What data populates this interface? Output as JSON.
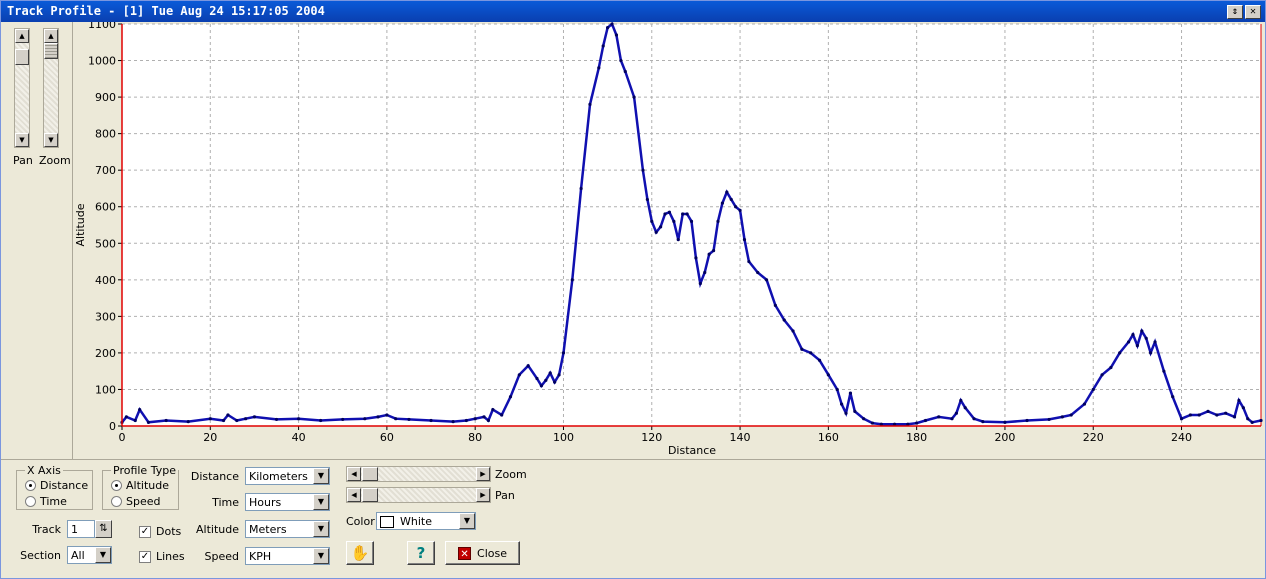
{
  "window": {
    "title": "Track Profile - [1] Tue Aug 24 15:17:05 2004",
    "restore_icon": "restore-icon",
    "close_icon": "close-icon"
  },
  "left_panel": {
    "pan_label": "Pan",
    "zoom_label": "Zoom"
  },
  "chart_data": {
    "type": "line",
    "xlabel": "Distance",
    "ylabel": "Altitude",
    "xlim": [
      0,
      258
    ],
    "ylim": [
      0,
      1100
    ],
    "xticks": [
      0,
      20,
      40,
      60,
      80,
      100,
      120,
      140,
      160,
      180,
      200,
      220,
      240
    ],
    "yticks": [
      0,
      100,
      200,
      300,
      400,
      500,
      600,
      700,
      800,
      900,
      1000,
      1100
    ],
    "ytick_labels": [
      "0",
      "100",
      "200",
      "300",
      "400",
      "500",
      "600",
      "700",
      "800",
      "900",
      "1000",
      "1100"
    ],
    "grid": true,
    "series_color": "#1010b0",
    "axis_color": "#e00000",
    "x": [
      0,
      1,
      3,
      4,
      6,
      10,
      15,
      20,
      23,
      24,
      26,
      28,
      30,
      35,
      40,
      45,
      50,
      55,
      58,
      60,
      62,
      65,
      70,
      75,
      78,
      80,
      82,
      83,
      84,
      86,
      88,
      90,
      92,
      94,
      95,
      96,
      97,
      98,
      99,
      100,
      102,
      104,
      106,
      108,
      109,
      110,
      111,
      112,
      113,
      114,
      116,
      118,
      119,
      120,
      121,
      122,
      123,
      124,
      125,
      126,
      127,
      128,
      129,
      130,
      131,
      132,
      133,
      134,
      135,
      136,
      137,
      138,
      139,
      140,
      141,
      142,
      144,
      146,
      148,
      150,
      152,
      154,
      156,
      158,
      160,
      162,
      163,
      164,
      165,
      166,
      168,
      170,
      172,
      175,
      178,
      180,
      182,
      185,
      188,
      189,
      190,
      191,
      193,
      195,
      200,
      205,
      210,
      213,
      215,
      218,
      220,
      222,
      224,
      226,
      228,
      229,
      230,
      231,
      232,
      233,
      234,
      236,
      238,
      240,
      242,
      244,
      246,
      248,
      250,
      252,
      253,
      254,
      255,
      256,
      258
    ],
    "y": [
      10,
      25,
      15,
      45,
      10,
      15,
      12,
      20,
      15,
      30,
      15,
      20,
      25,
      18,
      20,
      15,
      18,
      20,
      25,
      30,
      20,
      18,
      15,
      12,
      15,
      20,
      25,
      15,
      45,
      30,
      80,
      140,
      165,
      130,
      110,
      125,
      145,
      120,
      140,
      200,
      400,
      650,
      880,
      980,
      1040,
      1090,
      1100,
      1070,
      1000,
      970,
      900,
      700,
      620,
      560,
      530,
      545,
      580,
      585,
      560,
      510,
      580,
      580,
      560,
      460,
      390,
      420,
      470,
      480,
      560,
      610,
      640,
      620,
      600,
      590,
      510,
      450,
      420,
      400,
      330,
      290,
      260,
      210,
      200,
      180,
      140,
      100,
      60,
      35,
      90,
      40,
      20,
      8,
      5,
      5,
      5,
      8,
      15,
      25,
      20,
      35,
      70,
      50,
      20,
      12,
      10,
      15,
      18,
      25,
      30,
      60,
      100,
      140,
      160,
      200,
      230,
      250,
      220,
      260,
      240,
      200,
      230,
      150,
      80,
      20,
      30,
      30,
      40,
      30,
      35,
      25,
      70,
      50,
      20,
      10,
      15
    ]
  },
  "controls": {
    "xaxis_group_title": "X Axis",
    "xaxis_distance": "Distance",
    "xaxis_time": "Time",
    "profile_group_title": "Profile Type",
    "profile_altitude": "Altitude",
    "profile_speed": "Speed",
    "track_label": "Track",
    "track_value": "1",
    "section_label": "Section",
    "section_value": "All",
    "dots_label": "Dots",
    "lines_label": "Lines",
    "distance_label": "Distance",
    "distance_value": "Kilometers",
    "time_label": "Time",
    "time_value": "Hours",
    "altitude_label": "Altitude",
    "altitude_value": "Meters",
    "speed_label": "Speed",
    "speed_value": "KPH",
    "zoom_label": "Zoom",
    "pan_label": "Pan",
    "color_label": "Color",
    "color_value": "White",
    "close_label": "Close"
  }
}
